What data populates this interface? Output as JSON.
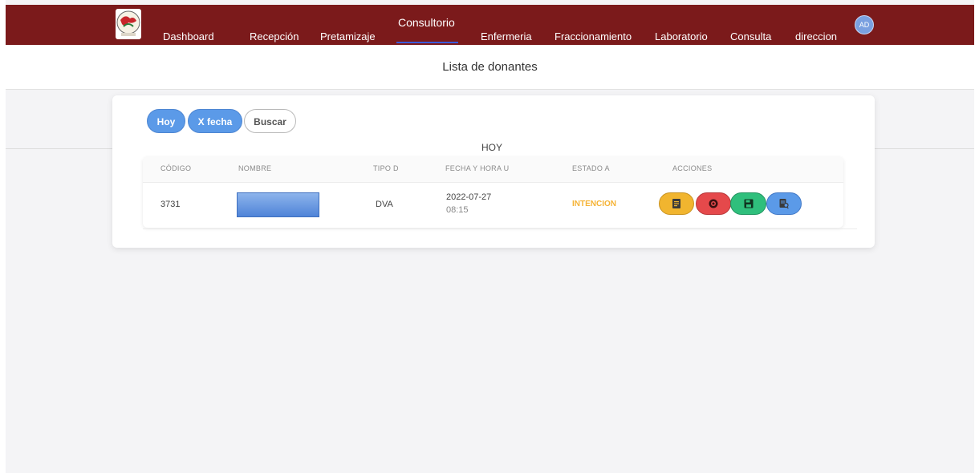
{
  "nav": {
    "items": [
      {
        "label": "Dashboard"
      },
      {
        "label": "Recepción"
      },
      {
        "label": "Pretamizaje"
      },
      {
        "label": "Consultorio"
      },
      {
        "label": "Enfermeria"
      },
      {
        "label": "Fraccionamiento"
      },
      {
        "label": "Laboratorio"
      },
      {
        "label": "Consulta"
      },
      {
        "label": "direccion"
      }
    ],
    "active": "Consultorio",
    "avatar_initials": "AD",
    "logo_icon": "institution-seal-logo"
  },
  "page": {
    "title": "Lista de donantes"
  },
  "filters": {
    "hoy": "Hoy",
    "fecha": "X fecha",
    "buscar": "Buscar"
  },
  "section": {
    "label": "HOY"
  },
  "table": {
    "headers": [
      "CÓDIGO",
      "NOMBRE",
      "TIPO D",
      "FECHA Y HORA U",
      "ESTADO A",
      "ACCIONES"
    ],
    "rows": [
      {
        "codigo": "3731",
        "nombre": "",
        "tipo": "DVA",
        "fecha": "2022-07-27",
        "hora": "08:15",
        "estado": "INTENCION",
        "actions": [
          {
            "icon": "document-icon",
            "color": "#f1b52f"
          },
          {
            "icon": "cancel-icon",
            "color": "#e5494b"
          },
          {
            "icon": "save-icon",
            "color": "#2fbf7c"
          },
          {
            "icon": "document-search-icon",
            "color": "#5b9ae8"
          }
        ]
      }
    ]
  },
  "colors": {
    "navbar": "#7b1a1b",
    "primary": "#5b9ae8",
    "warning": "#f5b335"
  }
}
